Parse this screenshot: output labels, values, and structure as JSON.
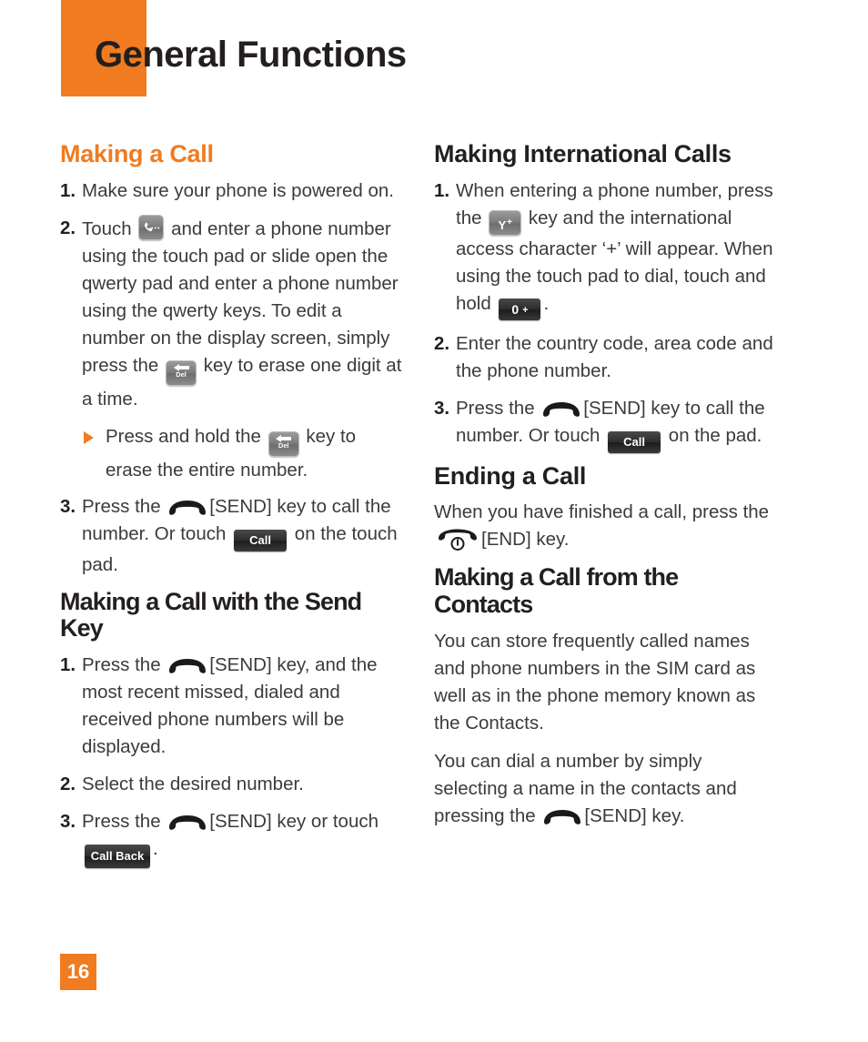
{
  "header": {
    "title": "General Functions",
    "accent_color": "#F07B20"
  },
  "page_number": "16",
  "left_column": {
    "sections": [
      {
        "heading": "Making a Call",
        "heading_color": "#F07B20",
        "steps": [
          {
            "num": "1.",
            "text": "Make sure your phone is powered on."
          },
          {
            "num": "2.",
            "text_a": "Touch ",
            "icon_a": "dial-key-icon",
            "text_b": " and enter a phone number using the touch pad or slide open the qwerty pad and enter a phone number using the qwerty keys. To edit a number on the display screen, simply press the ",
            "icon_b": "del-key-icon",
            "text_c": " key to erase one digit at a time."
          },
          {
            "num": "3.",
            "text_a": "Press the ",
            "icon_a": "send-key-icon",
            "text_b": "[SEND] key to call the number. Or touch ",
            "button": "Call",
            "text_c": " on the touch pad."
          }
        ],
        "sub_bullet": {
          "text_a": "Press and hold the ",
          "icon": "del-key-icon",
          "text_b": " key to erase the entire number."
        }
      },
      {
        "heading": "Making a Call with the Send Key",
        "heading_color": "#231f20",
        "steps": [
          {
            "num": "1.",
            "text_a": "Press the ",
            "icon_a": "send-key-icon",
            "text_b": "[SEND] key, and the most recent missed, dialed and received phone numbers will be displayed."
          },
          {
            "num": "2.",
            "text": "Select the desired number."
          },
          {
            "num": "3.",
            "text_a": "Press the ",
            "icon_a": "send-key-icon",
            "text_b": "[SEND] key or touch ",
            "button": "Call Back",
            "text_c": "."
          }
        ]
      }
    ]
  },
  "right_column": {
    "sections": [
      {
        "heading": "Making International Calls",
        "heading_color": "#231f20",
        "steps": [
          {
            "num": "1.",
            "text_a": "When entering a phone number, press the ",
            "key_label": "Y",
            "key_sup": "+",
            "text_b": " key and the international access character ‘+’ will appear. When using the touch pad to dial, touch and hold ",
            "button_digit": "0",
            "button_plus": "+",
            "text_c": "."
          },
          {
            "num": "2.",
            "text": "Enter the country code, area code and the phone number."
          },
          {
            "num": "3.",
            "text_a": "Press the ",
            "icon_a": "send-key-icon",
            "text_b": "[SEND] key to call the number. Or touch ",
            "button": "Call",
            "text_c": " on the pad."
          }
        ]
      },
      {
        "heading": "Ending a Call",
        "heading_color": "#231f20",
        "paragraphs": [
          {
            "text_a": "When you have finished a call, press the ",
            "icon": "end-key-icon",
            "text_b": "[END] key."
          }
        ]
      },
      {
        "heading": "Making a Call from the Contacts",
        "heading_color": "#231f20",
        "paragraphs": [
          {
            "text": "You can store frequently called names and phone numbers in the SIM card as well as in the phone memory known as the Contacts."
          },
          {
            "text_a": "You can dial a number by simply selecting a name in the contacts and pressing the ",
            "icon": "send-key-icon",
            "text_b": "[SEND] key."
          }
        ]
      }
    ]
  }
}
